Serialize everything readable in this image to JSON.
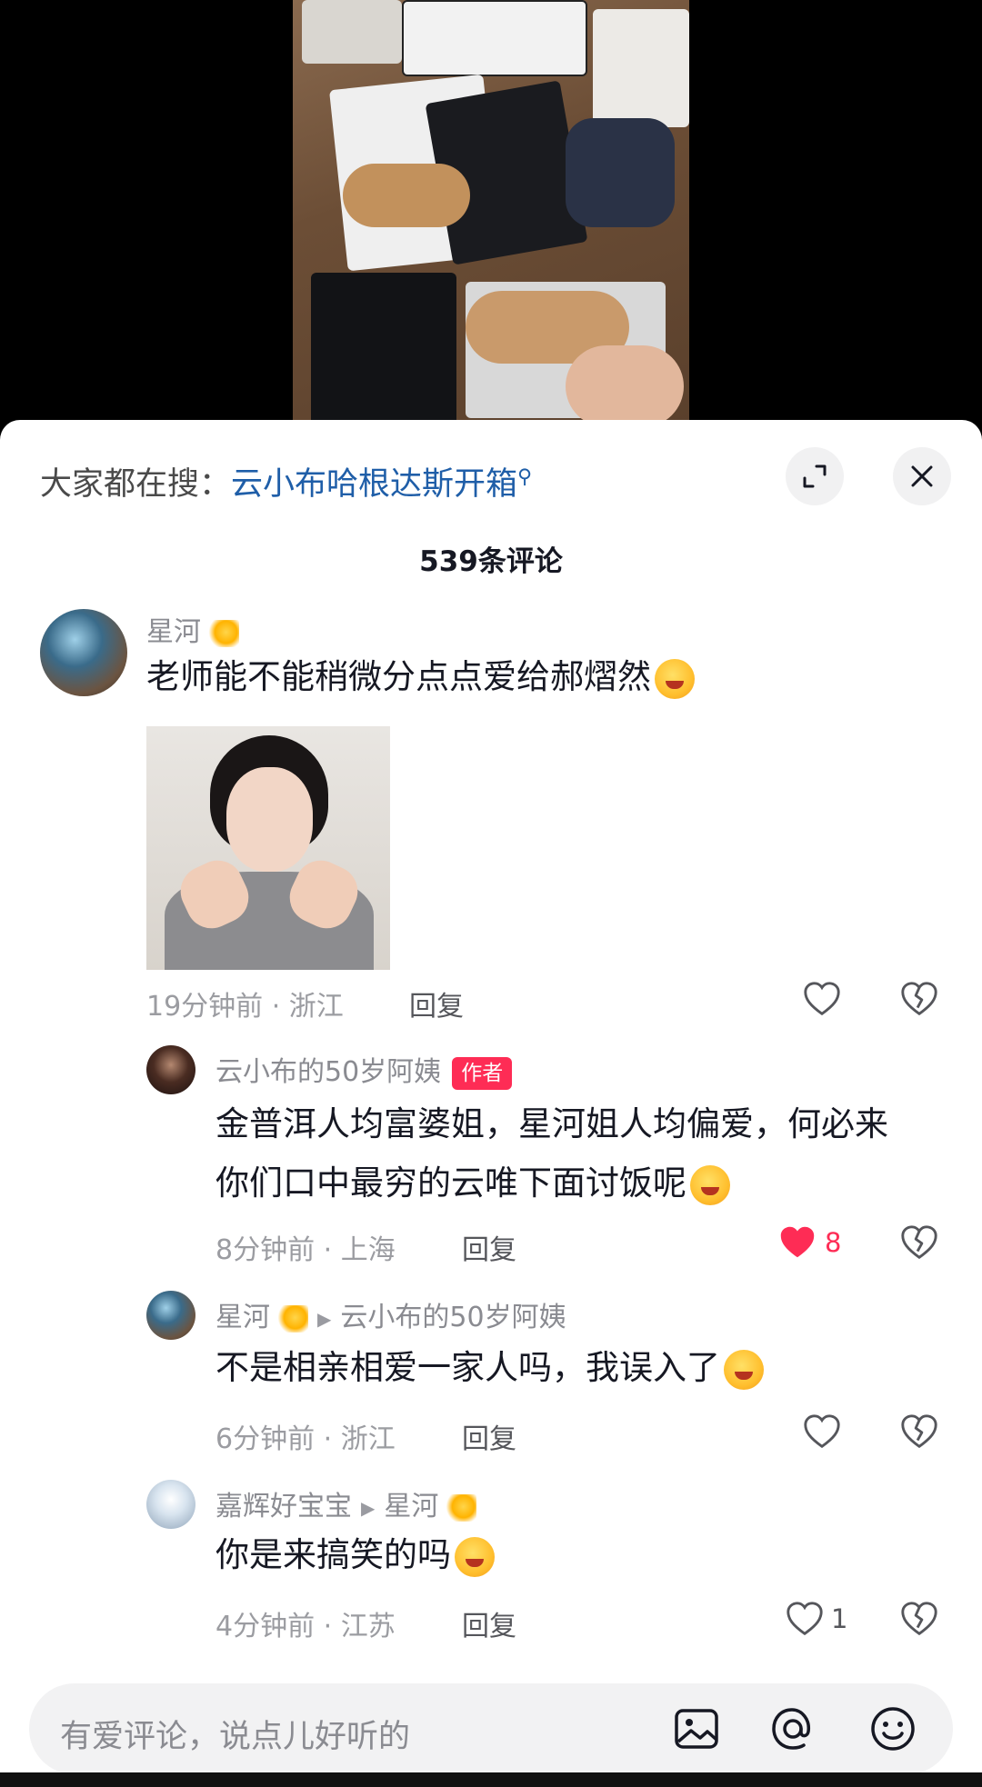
{
  "search_hint": {
    "prefix": "大家都在搜：",
    "keyword": "云小布哈根达斯开箱"
  },
  "header_buttons": {
    "expand_icon": "expand-icon",
    "close_icon": "close-icon"
  },
  "comment_count": "539条评论",
  "comments": [
    {
      "name": "星河",
      "text": "老师能不能稍微分点点爱给郝熠然",
      "time": "19分钟前 · 浙江",
      "reply": "回复",
      "likes": ""
    },
    {
      "name": "云小布的50岁阿姨",
      "badge": "作者",
      "text_line1": "金普洱人均富婆姐，星河姐人均偏爱，何必来",
      "text_line2": "你们口中最穷的云唯下面讨饭呢",
      "time": "8分钟前 · 上海",
      "reply": "回复",
      "likes": "8"
    },
    {
      "name": "星河",
      "reply_to": "云小布的50岁阿姨",
      "text": "不是相亲相爱一家人吗，我误入了",
      "time": "6分钟前 · 浙江",
      "reply": "回复",
      "likes": ""
    },
    {
      "name": "嘉辉好宝宝",
      "reply_to": "星河",
      "text": "你是来搞笑的吗",
      "time": "4分钟前 · 江苏",
      "reply": "回复",
      "likes": "1"
    }
  ],
  "input": {
    "placeholder": "有爱评论，说点儿好听的"
  },
  "colors": {
    "accent_red": "#fe2c55",
    "link_blue": "#1f5ea8"
  }
}
